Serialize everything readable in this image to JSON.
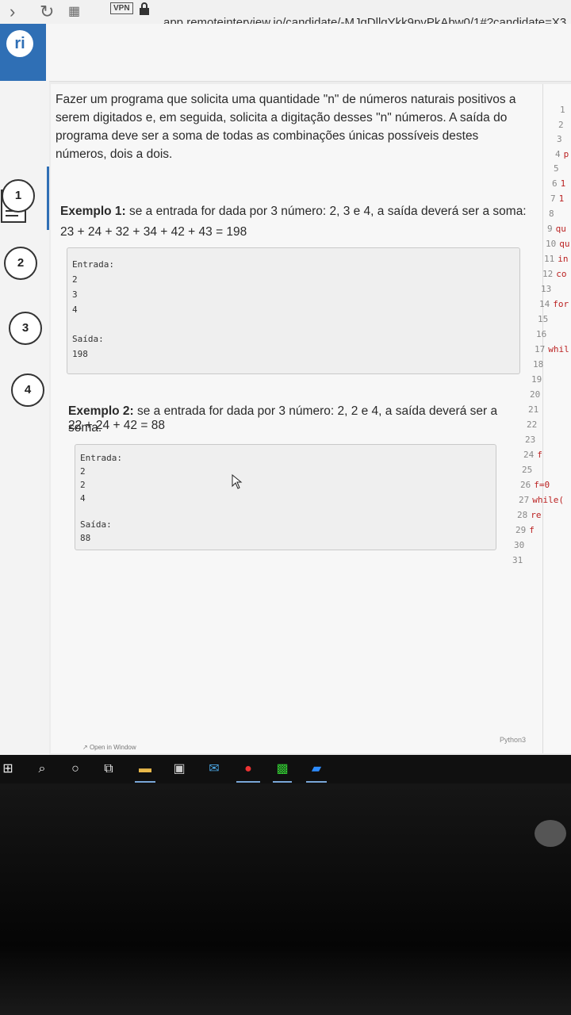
{
  "browser": {
    "vpn_label": "VPN",
    "url": "app.remoteinterview.io/candidate/-MJqDllqYkk9pvPkAbw0/1#?candidate=X3"
  },
  "app": {
    "logo_text": "ri"
  },
  "steps": [
    "1",
    "2",
    "3",
    "4"
  ],
  "problem": {
    "statement": "Fazer um programa que solicita uma quantidade \"n\" de números naturais positivos a serem digitados e, em seguida, solicita a digitação desses \"n\" números. A saída do programa deve ser a soma de todas as combinações únicas possíveis destes números, dois a dois."
  },
  "example1": {
    "title": "Exemplo 1:",
    "text": " se a entrada for dada por 3 número: 2, 3 e 4, a saída deverá ser a soma:",
    "formula": "23 + 24 + 32 + 34 + 42 + 43 = 198",
    "input_label": "Entrada:",
    "inputs": [
      "2",
      "3",
      "4"
    ],
    "output_label": "Saída:",
    "output": "198"
  },
  "example2": {
    "title": "Exemplo 2:",
    "text": " se a entrada for dada por 3 número: 2, 2 e 4, a saída deverá ser a soma:",
    "formula": "22 + 24 + 42 = 88",
    "input_label": "Entrada:",
    "inputs": [
      "2",
      "2",
      "4"
    ],
    "output_label": "Saída:",
    "output": "88"
  },
  "footer": {
    "open_in_window": "Open in Window"
  },
  "editor": {
    "language": "Python3",
    "lines": [
      {
        "n": "1",
        "code": ""
      },
      {
        "n": "2",
        "code": ""
      },
      {
        "n": "3",
        "code": ""
      },
      {
        "n": "4",
        "code": "p"
      },
      {
        "n": "5",
        "code": ""
      },
      {
        "n": "6",
        "code": "1"
      },
      {
        "n": "7",
        "code": "1"
      },
      {
        "n": "8",
        "code": ""
      },
      {
        "n": "9",
        "code": "qu"
      },
      {
        "n": "10",
        "code": "qu"
      },
      {
        "n": "11",
        "code": "in"
      },
      {
        "n": "12",
        "code": "co"
      },
      {
        "n": "13",
        "code": ""
      },
      {
        "n": "14",
        "code": "for"
      },
      {
        "n": "15",
        "code": ""
      },
      {
        "n": "16",
        "code": ""
      },
      {
        "n": "17",
        "code": "whil"
      },
      {
        "n": "18",
        "code": ""
      },
      {
        "n": "19",
        "code": ""
      },
      {
        "n": "20",
        "code": ""
      },
      {
        "n": "21",
        "code": ""
      },
      {
        "n": "22",
        "code": ""
      },
      {
        "n": "23",
        "code": ""
      },
      {
        "n": "24",
        "code": "f"
      },
      {
        "n": "25",
        "code": ""
      },
      {
        "n": "26",
        "code": "f=0"
      },
      {
        "n": "27",
        "code": "while("
      },
      {
        "n": "28",
        "code": "re"
      },
      {
        "n": "29",
        "code": "f"
      },
      {
        "n": "30",
        "code": ""
      },
      {
        "n": "31",
        "code": ""
      }
    ]
  }
}
